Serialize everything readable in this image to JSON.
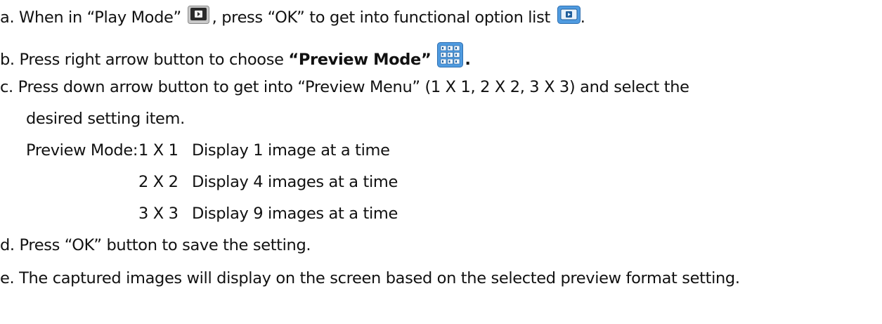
{
  "steps": {
    "a": {
      "part1": "a. When in “Play Mode” ",
      "play_icon": "play-mode-icon",
      "part2": ", press “OK” to get into functional option list ",
      "list_icon": "functional-option-list-icon",
      "part3": "."
    },
    "b": {
      "part1": "b. Press right arrow button to choose ",
      "bold": "“Preview Mode”",
      "preview_icon": "preview-mode-grid-icon",
      "part2": "."
    },
    "c": {
      "line1": "c. Press down arrow button to get into “Preview Menu” (1 X 1, 2 X 2, 3 X 3) and select the",
      "line2": "desired setting item."
    },
    "preview_modes": {
      "label": "Preview Mode:",
      "rows": [
        {
          "size": "1 X 1",
          "desc": "Display 1 image at a time"
        },
        {
          "size": "2 X 2",
          "desc": "Display 4 images at a time"
        },
        {
          "size": "3 X 3",
          "desc": "Display 9 images at a time"
        }
      ]
    },
    "d": {
      "text": "d. Press “OK” button to save the setting."
    },
    "e": {
      "text": "e. The captured images will display on the screen based on the selected preview format setting."
    }
  }
}
